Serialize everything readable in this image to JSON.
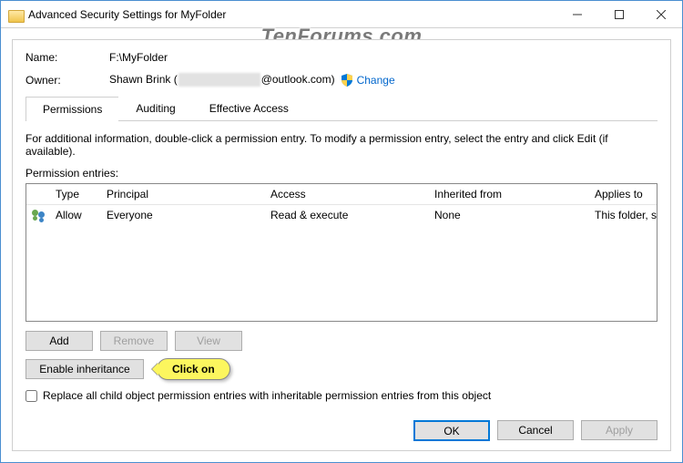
{
  "titlebar": {
    "title": "Advanced Security Settings for MyFolder"
  },
  "watermark": "TenForums.com",
  "overlay": "Folder",
  "fields": {
    "nameLabel": "Name:",
    "nameValue": "F:\\MyFolder",
    "ownerLabel": "Owner:",
    "ownerPrefix": "Shawn Brink (",
    "ownerSuffix": "@outlook.com)",
    "changeLink": "Change"
  },
  "tabs": {
    "permissions": "Permissions",
    "auditing": "Auditing",
    "effective": "Effective Access"
  },
  "infoText": "For additional information, double-click a permission entry. To modify a permission entry, select the entry and click Edit (if available).",
  "entriesLabel": "Permission entries:",
  "columns": {
    "blank": "",
    "type": "Type",
    "principal": "Principal",
    "access": "Access",
    "inherited": "Inherited from",
    "applies": "Applies to"
  },
  "rows": [
    {
      "type": "Allow",
      "principal": "Everyone",
      "access": "Read & execute",
      "inherited": "None",
      "applies": "This folder, subfolders and files"
    }
  ],
  "buttons": {
    "add": "Add",
    "remove": "Remove",
    "view": "View",
    "enableInheritance": "Enable inheritance",
    "ok": "OK",
    "cancel": "Cancel",
    "apply": "Apply"
  },
  "callout": "Click on",
  "replaceCheckbox": "Replace all child object permission entries with inheritable permission entries from this object"
}
